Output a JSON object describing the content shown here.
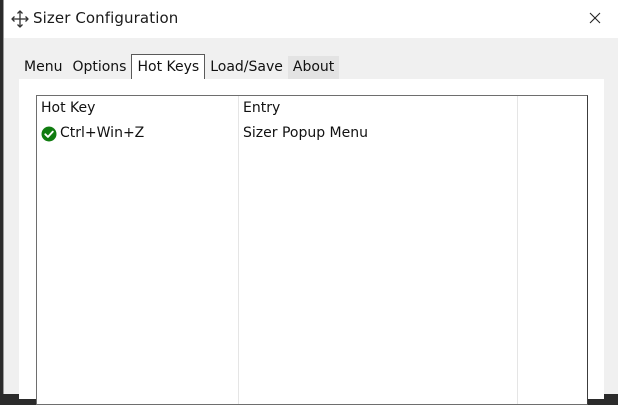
{
  "window": {
    "title": "Sizer Configuration",
    "app_icon": "move-arrows-icon",
    "close_icon": "close-icon"
  },
  "tabs": [
    {
      "label": "Menu",
      "active": false
    },
    {
      "label": "Options",
      "active": false
    },
    {
      "label": "Hot Keys",
      "active": true
    },
    {
      "label": "Load/Save",
      "active": false
    },
    {
      "label": "About",
      "active": false
    }
  ],
  "hotkeys_table": {
    "columns": [
      "Hot Key",
      "Entry"
    ],
    "rows": [
      {
        "hot_key": "Ctrl+Win+Z",
        "entry": "Sizer Popup Menu",
        "status_icon": "check-circle-icon",
        "status_color": "#107c10"
      }
    ]
  }
}
